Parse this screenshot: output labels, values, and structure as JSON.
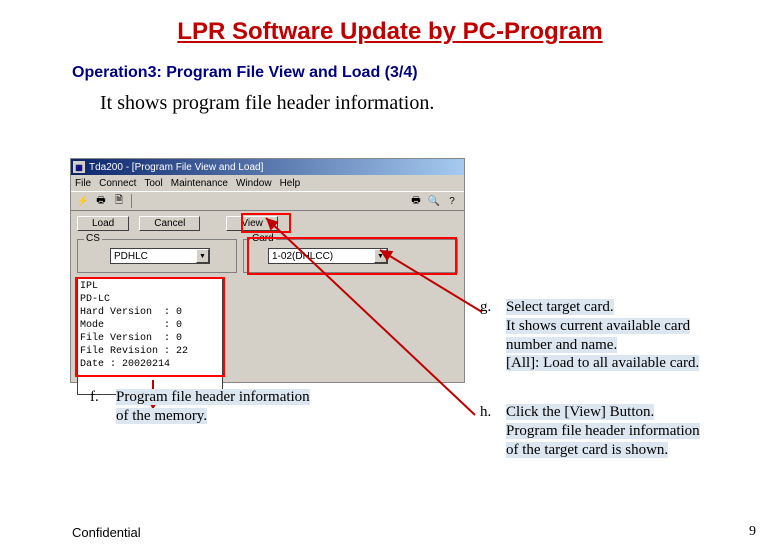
{
  "title": "LPR Software Update by PC-Program",
  "subtitle": "Operation3: Program File View and Load (3/4)",
  "description": "It shows program file header information.",
  "window": {
    "title": "Tda200 - [Program File View and Load]",
    "menu": {
      "file": "File",
      "connect": "Connect",
      "tool": "Tool",
      "maintenance": "Maintenance",
      "window": "Window",
      "help": "Help"
    },
    "buttons": {
      "load": "Load",
      "cancel": "Cancel",
      "view": "View"
    },
    "cs_label": "CS",
    "cs_value": "PDHLC",
    "card_label": "Card",
    "card_value": "1-02(DHLCC)",
    "header_text": "IPL\nPD-LC\nHard Version  : 0\nMode          : 0\nFile Version  : 0\nFile Revision : 22\nDate : 20020214"
  },
  "annotations": {
    "f": {
      "letter": "f.",
      "text_l1": "Program file header information",
      "text_l2": "of the memory."
    },
    "g": {
      "letter": "g.",
      "text_l1": "Select target card.",
      "text_l2": "It shows current available card",
      "text_l3": "number and name.",
      "text_l4": "[All]: Load to all available card."
    },
    "h": {
      "letter": "h.",
      "text_l1": "Click the [View] Button.",
      "text_l2": "Program file header information",
      "text_l3": "of the target card is shown."
    }
  },
  "footer": {
    "confidential": "Confidential",
    "page": "9"
  }
}
